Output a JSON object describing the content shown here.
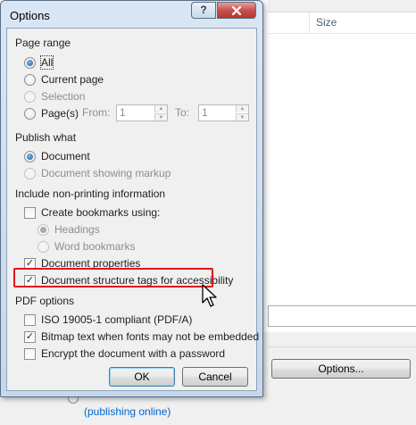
{
  "background": {
    "size_column": "Size",
    "options_button": "Options...",
    "link_text": "(publishing online)"
  },
  "dialog": {
    "title": "Options",
    "help_label": "?",
    "close_label": "X",
    "page_range": {
      "heading": "Page range",
      "all": "All",
      "current_page": "Current page",
      "selection": "Selection",
      "pages": "Page(s)",
      "from_label": "From:",
      "from_value": "1",
      "to_label": "To:",
      "to_value": "1"
    },
    "publish_what": {
      "heading": "Publish what",
      "document": "Document",
      "document_markup": "Document showing markup"
    },
    "non_printing": {
      "heading": "Include non-printing information",
      "create_bookmarks": "Create bookmarks using:",
      "headings": "Headings",
      "word_bookmarks": "Word bookmarks",
      "document_properties": "Document properties",
      "structure_tags": "Document structure tags for accessibility"
    },
    "pdf_options": {
      "heading": "PDF options",
      "iso": "ISO 19005-1 compliant (PDF/A)",
      "bitmap": "Bitmap text when fonts may not be embedded",
      "encrypt": "Encrypt the document with a password"
    },
    "ok": "OK",
    "cancel": "Cancel"
  },
  "colors": {
    "highlight": "#e0161b",
    "title_bar": "#c5d8ec",
    "close_button": "#c75050",
    "link": "#0066cc"
  },
  "icons": [
    "help-icon",
    "close-icon",
    "spin-up-icon",
    "spin-down-icon",
    "mouse-cursor-icon"
  ]
}
